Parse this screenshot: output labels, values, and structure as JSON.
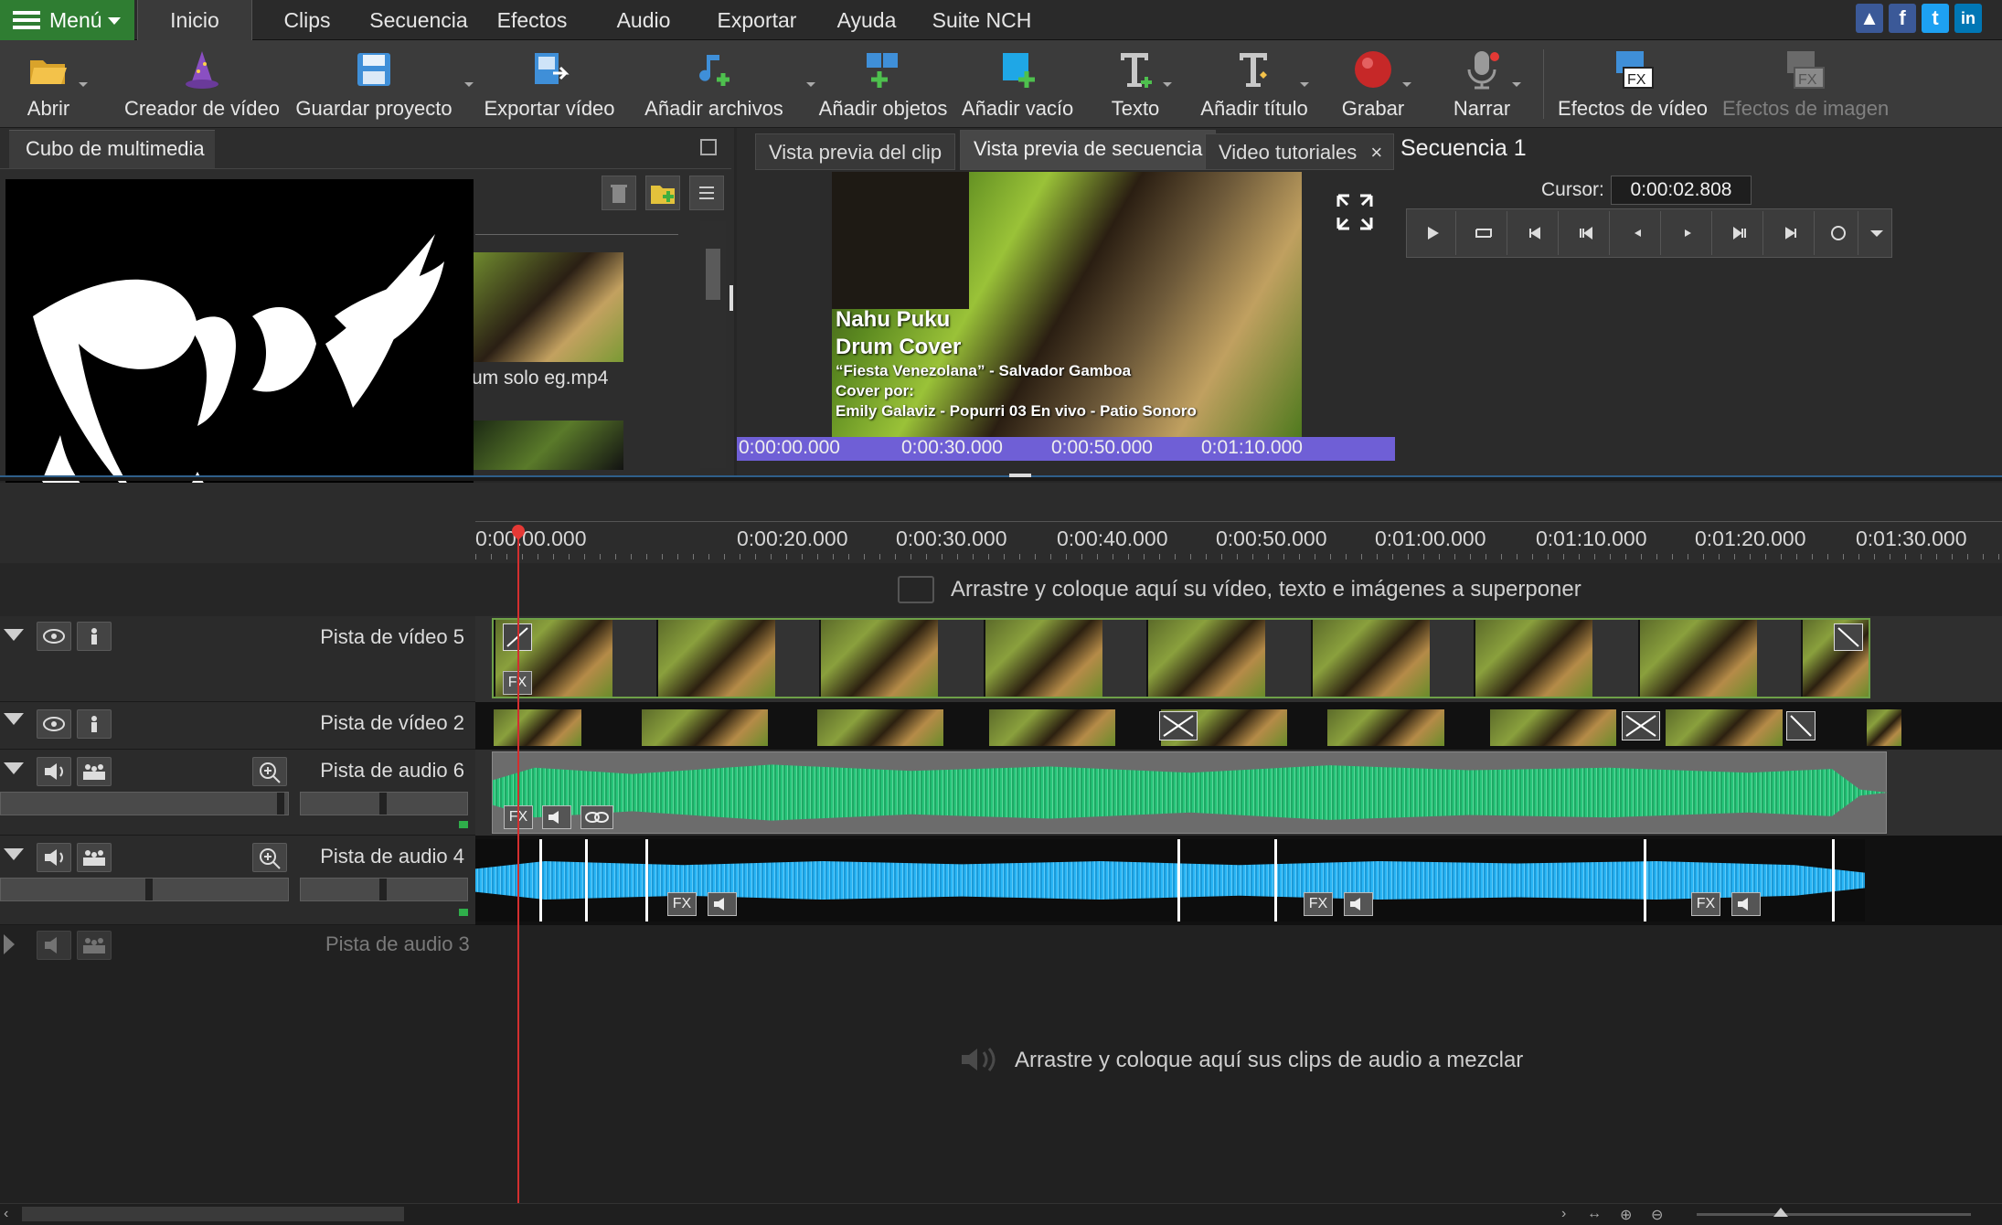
{
  "menubar": {
    "menu_label": "Menú",
    "tabs": [
      "Inicio",
      "Clips",
      "Secuencia",
      "Efectos",
      "Audio",
      "Exportar",
      "Ayuda",
      "Suite NCH"
    ],
    "social": [
      "like-icon",
      "facebook-icon",
      "twitter-icon",
      "linkedin-icon"
    ]
  },
  "toolbar": {
    "items": [
      {
        "label": "Abrir",
        "icon": "folder-open-icon"
      },
      {
        "label": "Creador de vídeo",
        "icon": "wizard-hat-icon"
      },
      {
        "label": "Guardar proyecto",
        "icon": "save-floppy-icon"
      },
      {
        "label": "Exportar vídeo",
        "icon": "export-video-icon"
      },
      {
        "label": "Añadir archivos",
        "icon": "add-files-icon"
      },
      {
        "label": "Añadir objetos",
        "icon": "add-objects-icon"
      },
      {
        "label": "Añadir vacío",
        "icon": "add-blank-icon"
      },
      {
        "label": "Texto",
        "icon": "text-icon"
      },
      {
        "label": "Añadir título",
        "icon": "add-title-icon"
      },
      {
        "label": "Grabar",
        "icon": "record-icon"
      },
      {
        "label": "Narrar",
        "icon": "microphone-icon"
      },
      {
        "label": "Efectos de vídeo",
        "icon": "video-fx-icon"
      },
      {
        "label": "Efectos de imagen",
        "icon": "image-fx-icon"
      }
    ]
  },
  "media_bin": {
    "tab_label": "Cubo de multimedia",
    "file_name": "um solo eg.mp4"
  },
  "preview": {
    "tabs": [
      "Vista previa del clip",
      "Vista previa de secuencia",
      "Video tutoriales"
    ],
    "sequence_title": "Secuencia 1",
    "cursor_label": "Cursor:",
    "cursor_value": "0:00:02.808",
    "overlay": {
      "line1": "Nahu Puku",
      "line2": "Drum Cover",
      "line3": "“Fiesta Venezolana” - Salvador Gamboa",
      "line4": "Cover por:",
      "line5": "Emily Galaviz - Popurri 03 En vivo - Patio Sonoro"
    },
    "mini_ruler": [
      "0:00:00.000",
      "0:00:30.000",
      "0:00:50.000",
      "0:01:10.000"
    ]
  },
  "timeline": {
    "ruler": [
      "0:00:00.000",
      "0:00:20.000",
      "0:00:30.000",
      "0:00:40.000",
      "0:00:50.000",
      "0:01:00.000",
      "0:01:10.000",
      "0:01:20.000",
      "0:01:30.000"
    ],
    "overlay_hint": "Arrastre y coloque aquí su vídeo, texto e imágenes a superponer",
    "audio_hint": "Arrastre y coloque aquí sus clips de audio a mezclar",
    "tracks": {
      "video5": "Pista de vídeo 5",
      "video2": "Pista de vídeo 2",
      "audio6": "Pista de audio 6",
      "audio4": "Pista de audio 4",
      "audio3": "Pista de audio 3"
    },
    "fx_label": "FX"
  }
}
